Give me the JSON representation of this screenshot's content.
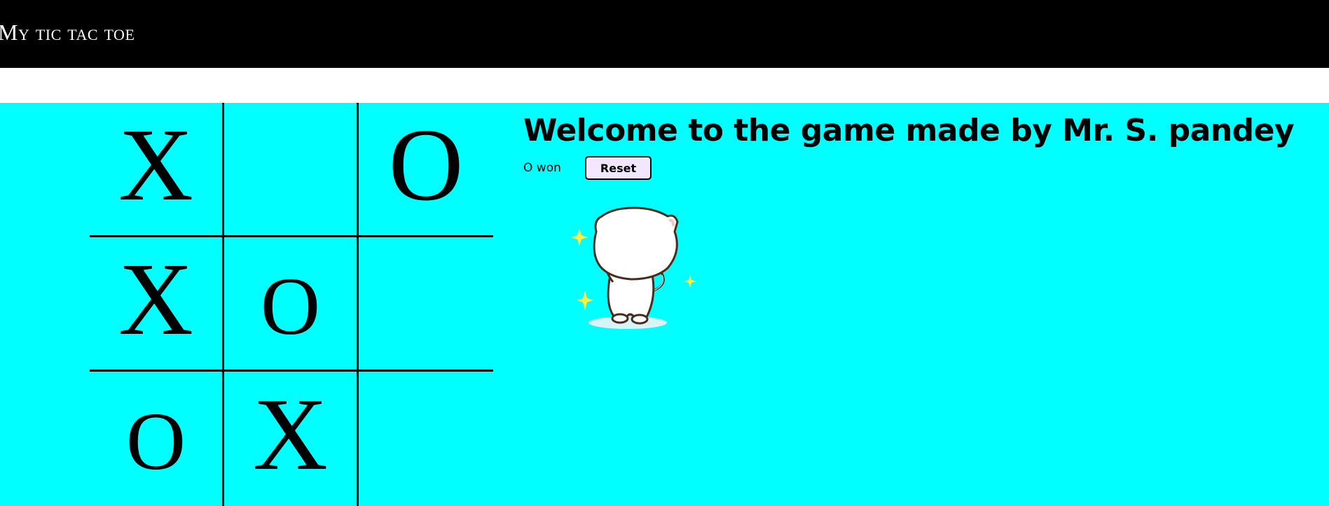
{
  "navbar": {
    "title": "My tic tac toe"
  },
  "board": {
    "cells": [
      "X",
      "",
      "O",
      "X",
      "O",
      "",
      "O",
      "X",
      ""
    ]
  },
  "info": {
    "welcome": "Welcome to the game made by Mr. S. pandey",
    "status": "O won",
    "reset_label": "Reset",
    "celebration_icon": "cat-celebration-gif"
  },
  "colors": {
    "navbar_bg": "#000000",
    "game_bg": "#00ffff",
    "button_bg": "#f3e6ff",
    "sparkle": "#ffee44"
  }
}
